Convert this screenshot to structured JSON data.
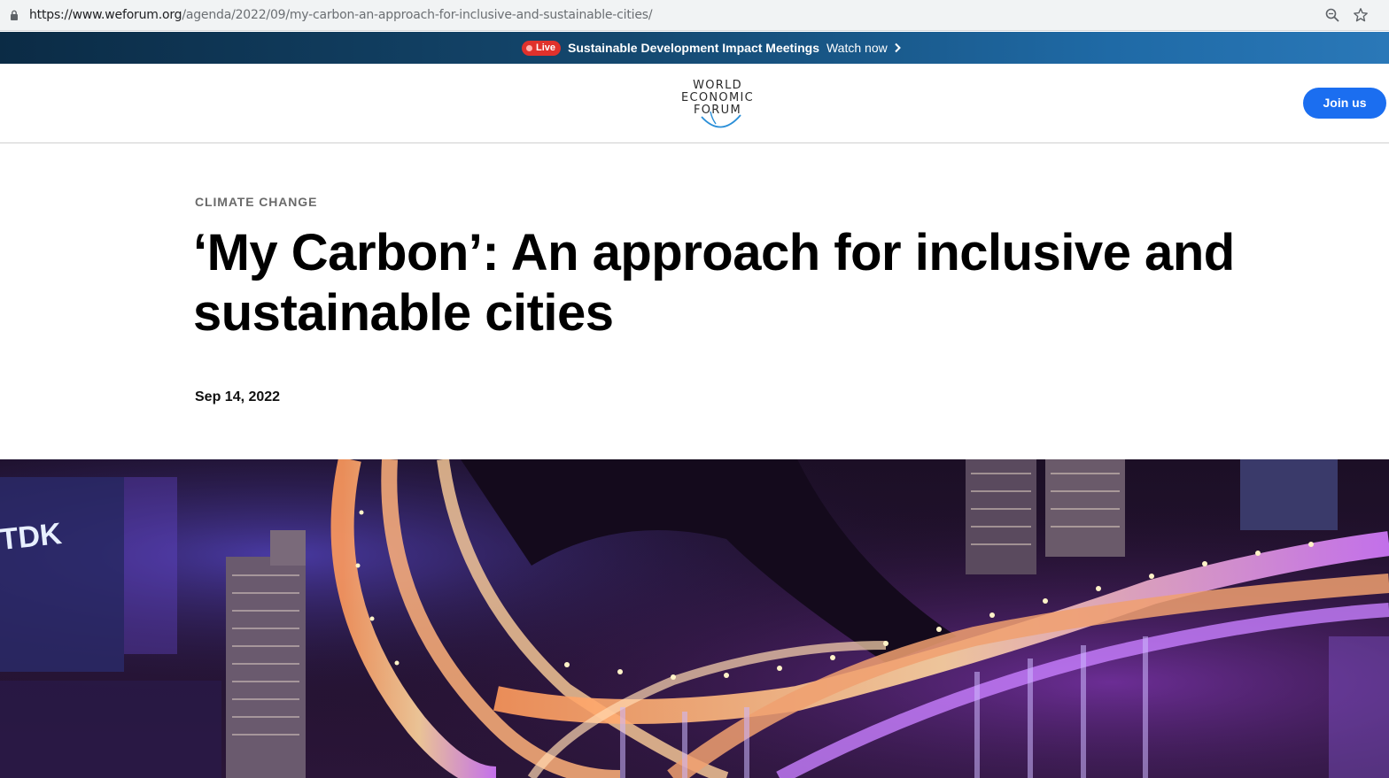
{
  "browser": {
    "url_host": "https://www.weforum.org",
    "url_path": "/agenda/2022/09/my-carbon-an-approach-for-inclusive-and-sustainable-cities/",
    "icons": [
      "lock-icon",
      "zoom-icon",
      "star-icon"
    ]
  },
  "banner": {
    "live_label": "Live",
    "title": "Sustainable Development Impact Meetings",
    "watch_label": "Watch now",
    "live_color": "#e0312c"
  },
  "header": {
    "logo_lines": [
      "WORLD",
      "ECONOMIC",
      "FORUM"
    ],
    "join_label": "Join us",
    "accent": "#1b6ef0"
  },
  "article": {
    "category": "CLIMATE CHANGE",
    "title": "‘My Carbon’: An approach for inclusive and sustainable cities",
    "date": "Sep 14, 2022"
  },
  "hero": {
    "sign_text": "TDK"
  }
}
